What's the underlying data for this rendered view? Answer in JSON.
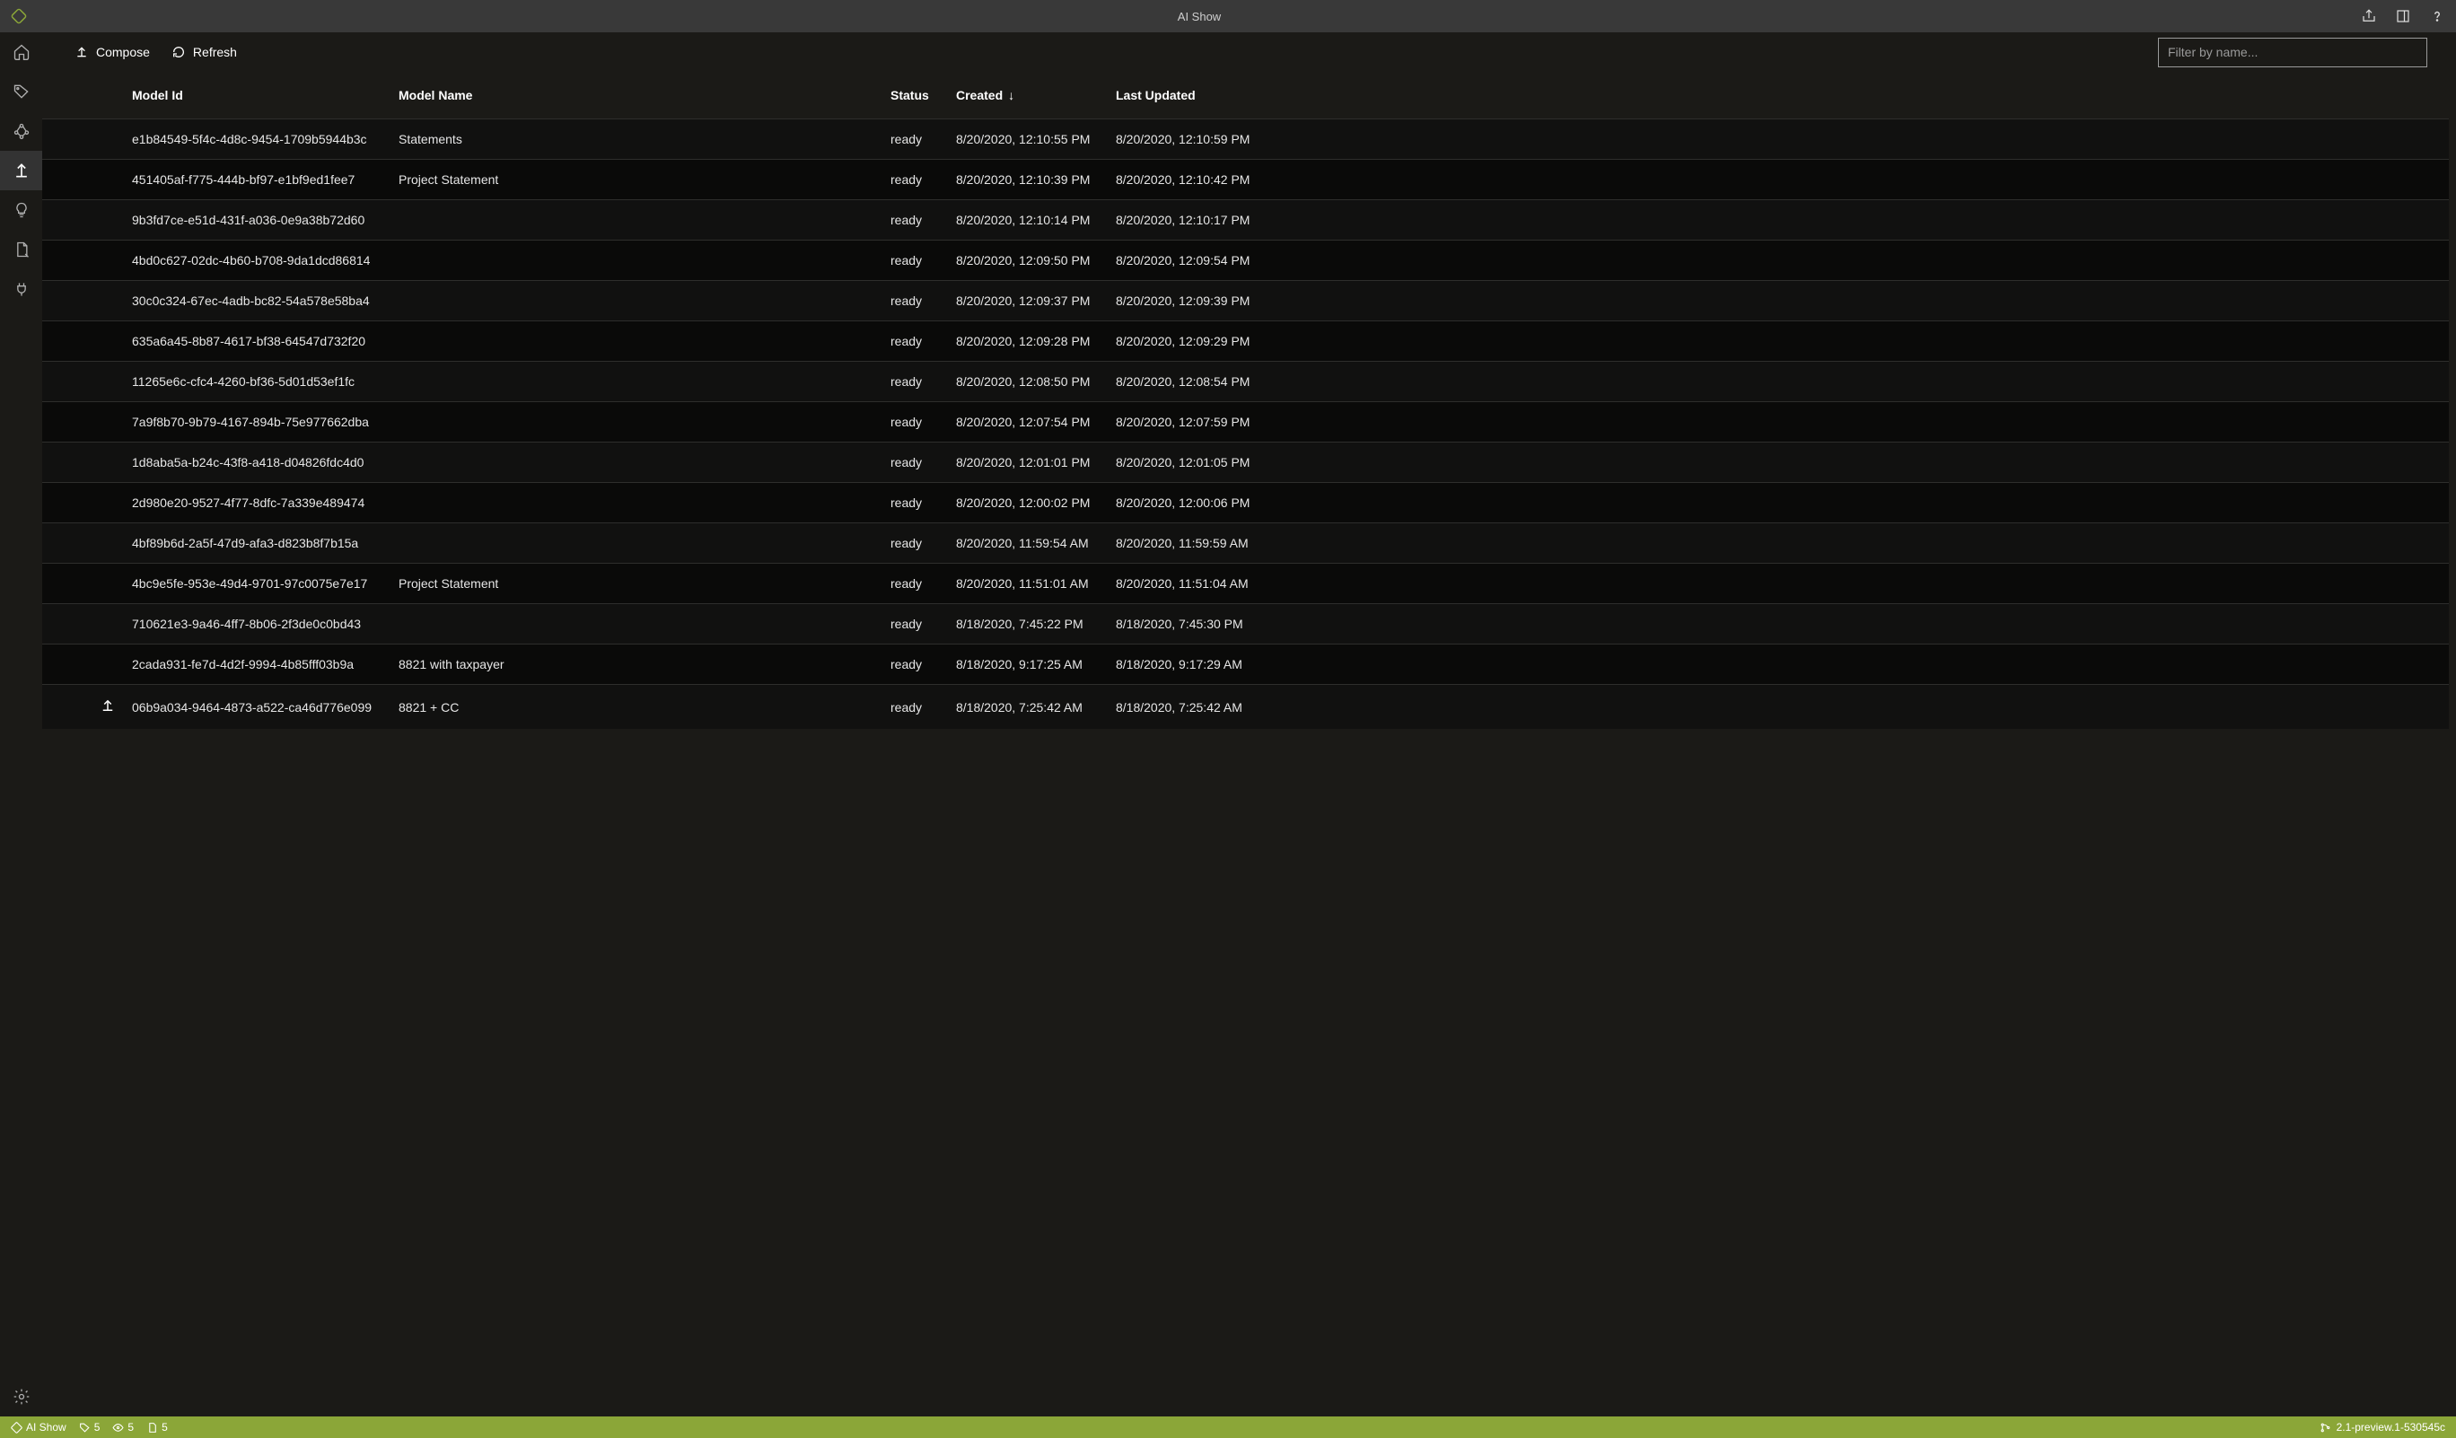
{
  "titlebar": {
    "title": "AI Show"
  },
  "toolbar": {
    "compose_label": "Compose",
    "refresh_label": "Refresh",
    "filter_placeholder": "Filter by name..."
  },
  "table": {
    "headers": {
      "model_id": "Model Id",
      "model_name": "Model Name",
      "status": "Status",
      "created": "Created",
      "last_updated": "Last Updated"
    },
    "sort_arrow": "↓",
    "rows": [
      {
        "icon": "",
        "id": "e1b84549-5f4c-4d8c-9454-1709b5944b3c",
        "name": "Statements",
        "status": "ready",
        "created": "8/20/2020, 12:10:55 PM",
        "updated": "8/20/2020, 12:10:59 PM"
      },
      {
        "icon": "",
        "id": "451405af-f775-444b-bf97-e1bf9ed1fee7",
        "name": "Project Statement",
        "status": "ready",
        "created": "8/20/2020, 12:10:39 PM",
        "updated": "8/20/2020, 12:10:42 PM"
      },
      {
        "icon": "",
        "id": "9b3fd7ce-e51d-431f-a036-0e9a38b72d60",
        "name": "",
        "status": "ready",
        "created": "8/20/2020, 12:10:14 PM",
        "updated": "8/20/2020, 12:10:17 PM"
      },
      {
        "icon": "",
        "id": "4bd0c627-02dc-4b60-b708-9da1dcd86814",
        "name": "",
        "status": "ready",
        "created": "8/20/2020, 12:09:50 PM",
        "updated": "8/20/2020, 12:09:54 PM"
      },
      {
        "icon": "",
        "id": "30c0c324-67ec-4adb-bc82-54a578e58ba4",
        "name": "",
        "status": "ready",
        "created": "8/20/2020, 12:09:37 PM",
        "updated": "8/20/2020, 12:09:39 PM"
      },
      {
        "icon": "",
        "id": "635a6a45-8b87-4617-bf38-64547d732f20",
        "name": "",
        "status": "ready",
        "created": "8/20/2020, 12:09:28 PM",
        "updated": "8/20/2020, 12:09:29 PM"
      },
      {
        "icon": "",
        "id": "11265e6c-cfc4-4260-bf36-5d01d53ef1fc",
        "name": "",
        "status": "ready",
        "created": "8/20/2020, 12:08:50 PM",
        "updated": "8/20/2020, 12:08:54 PM"
      },
      {
        "icon": "",
        "id": "7a9f8b70-9b79-4167-894b-75e977662dba",
        "name": "",
        "status": "ready",
        "created": "8/20/2020, 12:07:54 PM",
        "updated": "8/20/2020, 12:07:59 PM"
      },
      {
        "icon": "",
        "id": "1d8aba5a-b24c-43f8-a418-d04826fdc4d0",
        "name": "",
        "status": "ready",
        "created": "8/20/2020, 12:01:01 PM",
        "updated": "8/20/2020, 12:01:05 PM"
      },
      {
        "icon": "",
        "id": "2d980e20-9527-4f77-8dfc-7a339e489474",
        "name": "",
        "status": "ready",
        "created": "8/20/2020, 12:00:02 PM",
        "updated": "8/20/2020, 12:00:06 PM"
      },
      {
        "icon": "",
        "id": "4bf89b6d-2a5f-47d9-afa3-d823b8f7b15a",
        "name": "",
        "status": "ready",
        "created": "8/20/2020, 11:59:54 AM",
        "updated": "8/20/2020, 11:59:59 AM"
      },
      {
        "icon": "",
        "id": "4bc9e5fe-953e-49d4-9701-97c0075e7e17",
        "name": "Project Statement",
        "status": "ready",
        "created": "8/20/2020, 11:51:01 AM",
        "updated": "8/20/2020, 11:51:04 AM"
      },
      {
        "icon": "",
        "id": "710621e3-9a46-4ff7-8b06-2f3de0c0bd43",
        "name": "",
        "status": "ready",
        "created": "8/18/2020, 7:45:22 PM",
        "updated": "8/18/2020, 7:45:30 PM"
      },
      {
        "icon": "",
        "id": "2cada931-fe7d-4d2f-9994-4b85fff03b9a",
        "name": "8821 with taxpayer",
        "status": "ready",
        "created": "8/18/2020, 9:17:25 AM",
        "updated": "8/18/2020, 9:17:29 AM"
      },
      {
        "icon": "merge",
        "id": "06b9a034-9464-4873-a522-ca46d776e099",
        "name": "8821 + CC",
        "status": "ready",
        "created": "8/18/2020, 7:25:42 AM",
        "updated": "8/18/2020, 7:25:42 AM"
      }
    ]
  },
  "statusbar": {
    "project": "AI Show",
    "tags_count": "5",
    "views_count": "5",
    "docs_count": "5",
    "version": "2.1-preview.1-530545c"
  }
}
